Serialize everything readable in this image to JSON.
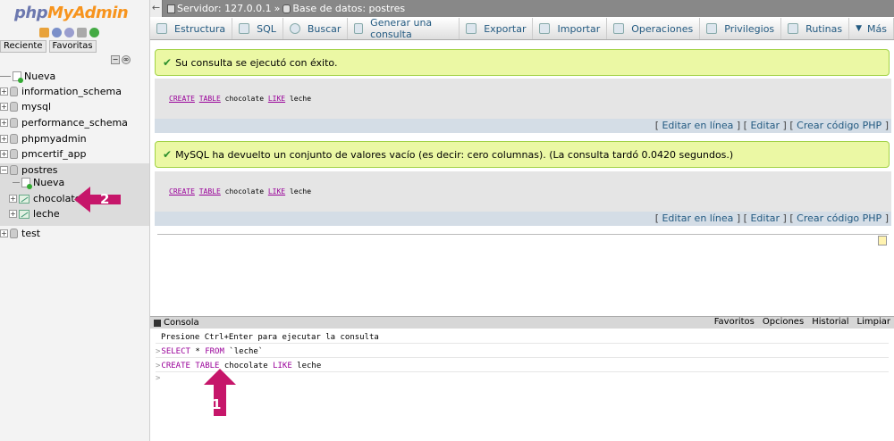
{
  "logo": {
    "text_a": "php",
    "text_b": "MyAdmin"
  },
  "nav": {
    "tabs": [
      "Reciente",
      "Favoritas"
    ],
    "tree": {
      "nueva_root": "Nueva",
      "dbs": [
        "information_schema",
        "mysql",
        "performance_schema",
        "phpmyadmin",
        "pmcertif_app"
      ],
      "postres": "postres",
      "postres_nueva": "Nueva",
      "tables": [
        "chocolate",
        "leche"
      ],
      "test": "test"
    }
  },
  "breadcrumb": {
    "server": "Servidor: 127.0.0.1",
    "sep": "»",
    "database": "Base de datos: postres"
  },
  "tabs": [
    "Estructura",
    "SQL",
    "Buscar",
    "Generar una consulta",
    "Exportar",
    "Importar",
    "Operaciones",
    "Privilegios",
    "Rutinas",
    "Más"
  ],
  "messages": {
    "success1": "Su consulta se ejecutó con éxito.",
    "success2": "MySQL ha devuelto un conjunto de valores vacío (es decir: cero columnas). (La consulta tardó 0.0420 segundos.)"
  },
  "sql": {
    "kw_create": "CREATE",
    "kw_table": "TABLE",
    "name": "chocolate",
    "kw_like": "LIKE",
    "src": "leche"
  },
  "links": {
    "open": "[",
    "close": "]",
    "inline": "Editar en línea",
    "edit": "Editar",
    "php": "Crear código PHP"
  },
  "console": {
    "title": "Consola",
    "menu": [
      "Favoritos",
      "Opciones",
      "Historial",
      "Limpiar"
    ],
    "hint": "Presione Ctrl+Enter para ejecutar la consulta",
    "q1_kw1": "SELECT",
    "q1_rest1": " * ",
    "q1_kw2": "FROM",
    "q1_rest2": " `leche`",
    "q2": "CREATE TABLE chocolate LIKE leche",
    "prompt": ">"
  },
  "annotations": {
    "arrow1": "1",
    "arrow2": "2"
  },
  "colors": {
    "accent_arrow": "#c6166a",
    "success_bg": "#ebf8a4",
    "link": "#235a81"
  }
}
